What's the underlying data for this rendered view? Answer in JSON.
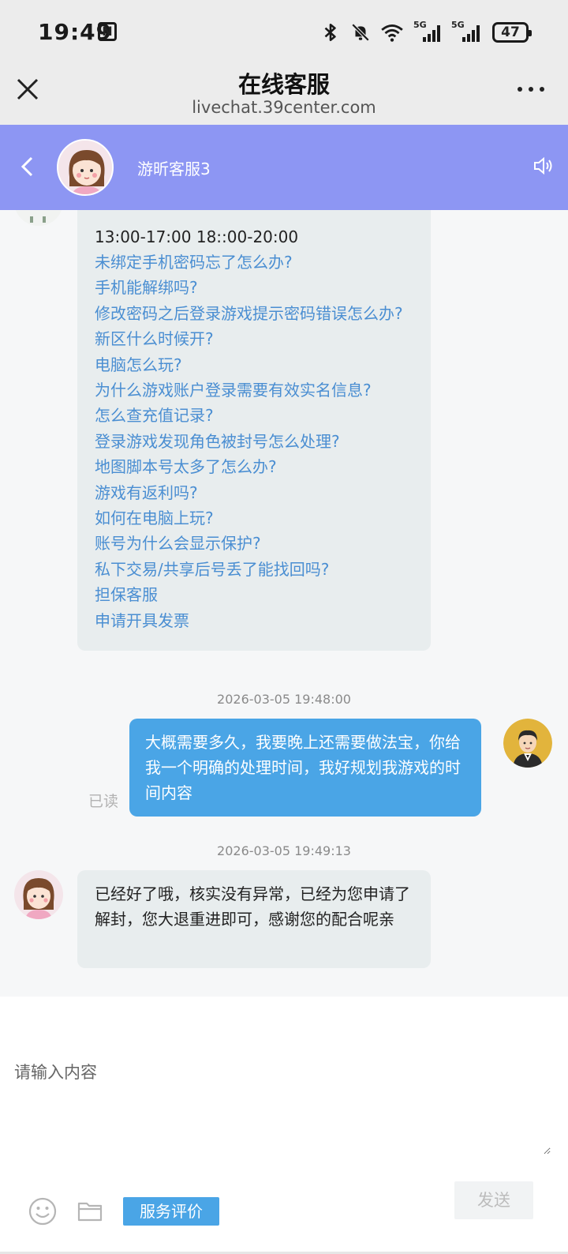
{
  "status_bar": {
    "time": "19:49",
    "nfc_label": "N",
    "signal_1_tag": "5G",
    "signal_2_tag": "5G",
    "battery": "47",
    "icons": [
      "nfc-icon",
      "bluetooth-icon",
      "bell-muted-icon",
      "wifi-icon",
      "signal-icon",
      "signal-icon",
      "battery-icon"
    ]
  },
  "titlebar": {
    "title": "在线客服",
    "url": "livechat.39center.com"
  },
  "chat_header": {
    "agent_name": "游昕客服3",
    "bg_color": "#8d96f3"
  },
  "faq_card": {
    "hours": "13:00-17:00 18::00-20:00",
    "links": [
      "未绑定手机密码忘了怎么办?",
      "手机能解绑吗?",
      "修改密码之后登录游戏提示密码错误怎么办?",
      "新区什么时候开?",
      "电脑怎么玩?",
      "为什么游戏账户登录需要有效实名信息?",
      "怎么查充值记录?",
      "登录游戏发现角色被封号怎么处理?",
      "地图脚本号太多了怎么办?",
      "游戏有返利吗?",
      "如何在电脑上玩?",
      "账号为什么会显示保护?",
      "私下交易/共享后号丢了能找回吗?",
      "担保客服",
      "申请开具发票"
    ],
    "link_color": "#4a8ed2"
  },
  "messages": [
    {
      "timestamp": "2026-03-05 19:48:00",
      "sender": "user",
      "text": "大概需要多久，我要晚上还需要做法宝，你给我一个明确的处理时间，我好规划我游戏的时间内容",
      "read_status": "已读"
    },
    {
      "timestamp": "2026-03-05 19:49:13",
      "sender": "agent",
      "text": "已经好了哦，核实没有异常，已经为您申请了解封，您大退重进即可，感谢您的配合呢亲"
    }
  ],
  "input": {
    "placeholder": "请输入内容",
    "value": "",
    "rate_label": "服务评价",
    "send_label": "发送"
  },
  "colors": {
    "accent": "#4aa5e6",
    "header": "#8d96f3",
    "incoming_bubble": "#e8edee"
  }
}
